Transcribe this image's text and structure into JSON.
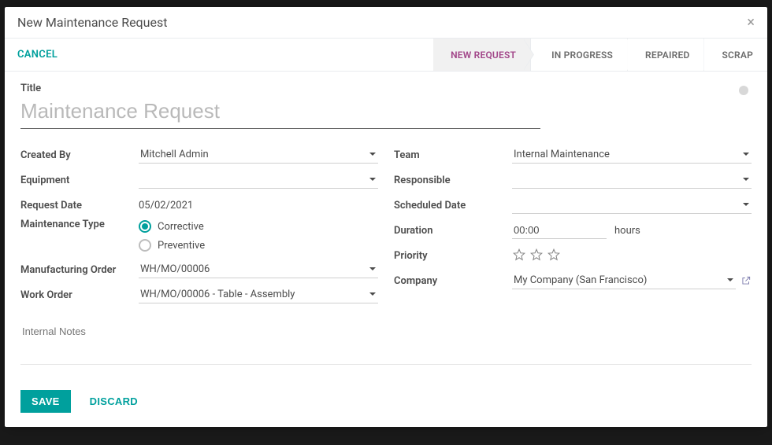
{
  "dialog": {
    "title": "New Maintenance Request",
    "close_icon": "close-icon"
  },
  "actions": {
    "cancel": "CANCEL",
    "stages": [
      "NEW REQUEST",
      "IN PROGRESS",
      "REPAIRED",
      "SCRAP"
    ],
    "active_stage_index": 0
  },
  "form": {
    "title_label": "Title",
    "title_placeholder": "Maintenance Request",
    "title_value": "",
    "left": {
      "created_by": {
        "label": "Created By",
        "value": "Mitchell Admin"
      },
      "equipment": {
        "label": "Equipment",
        "value": ""
      },
      "request_date": {
        "label": "Request Date",
        "value": "05/02/2021"
      },
      "maintenance_type": {
        "label": "Maintenance Type",
        "options": [
          {
            "key": "corrective",
            "label": "Corrective",
            "checked": true
          },
          {
            "key": "preventive",
            "label": "Preventive",
            "checked": false
          }
        ]
      },
      "manufacturing_order": {
        "label": "Manufacturing Order",
        "value": "WH/MO/00006"
      },
      "work_order": {
        "label": "Work Order",
        "value": "WH/MO/00006 - Table - Assembly"
      }
    },
    "right": {
      "team": {
        "label": "Team",
        "value": "Internal Maintenance"
      },
      "responsible": {
        "label": "Responsible",
        "value": ""
      },
      "scheduled_date": {
        "label": "Scheduled Date",
        "value": ""
      },
      "duration": {
        "label": "Duration",
        "value": "00:00",
        "unit": "hours"
      },
      "priority": {
        "label": "Priority",
        "stars": 3,
        "value": 0
      },
      "company": {
        "label": "Company",
        "value": "My Company (San Francisco)"
      }
    },
    "notes_placeholder": "Internal Notes"
  },
  "footer": {
    "save": "SAVE",
    "discard": "DISCARD"
  }
}
